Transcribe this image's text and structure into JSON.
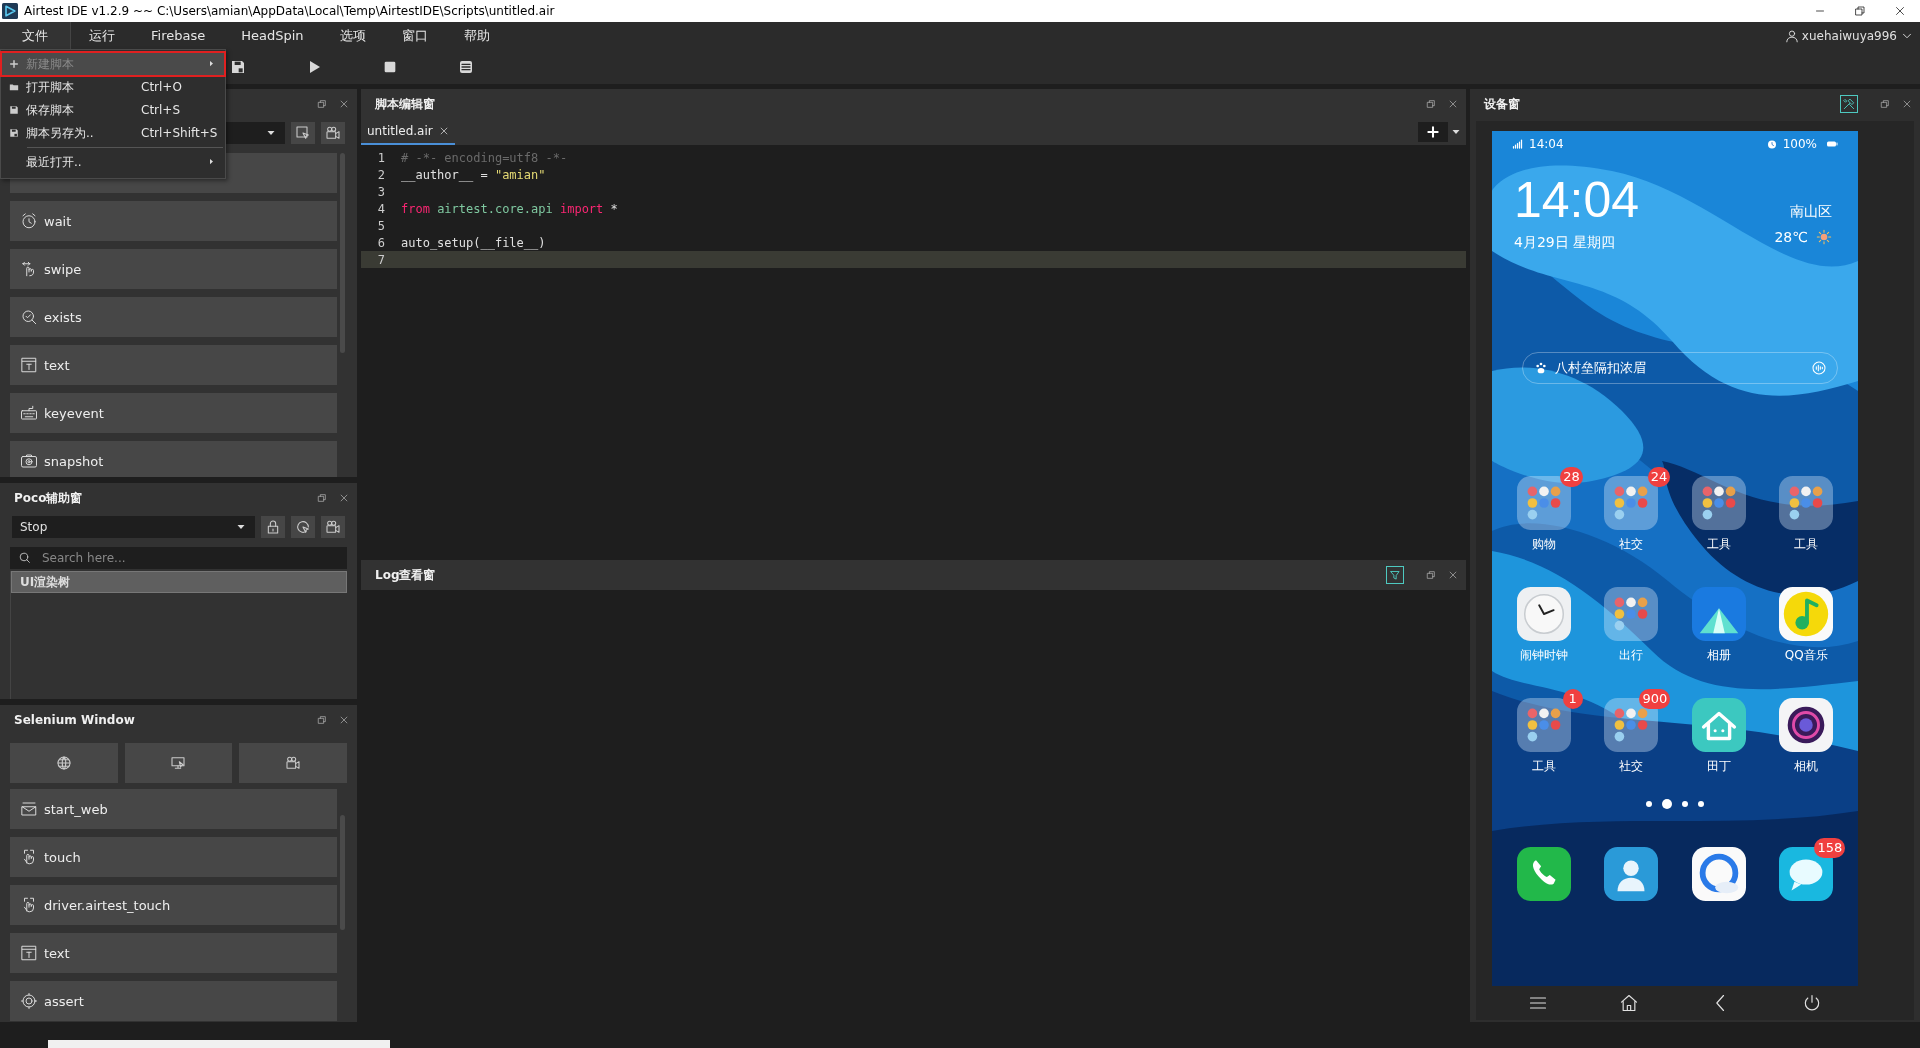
{
  "window": {
    "title": "Airtest IDE v1.2.9 ~~ C:\\Users\\amian\\AppData\\Local\\Temp\\AirtestIDE\\Scripts\\untitled.air"
  },
  "menubar": {
    "items": [
      {
        "label": "文件",
        "open": true
      },
      {
        "label": "运行",
        "open": false
      },
      {
        "label": "Firebase",
        "open": false
      },
      {
        "label": "HeadSpin",
        "open": false
      },
      {
        "label": "选项",
        "open": false
      },
      {
        "label": "窗口",
        "open": false
      },
      {
        "label": "帮助",
        "open": false
      }
    ],
    "user": "xuehaiwuya996"
  },
  "file_menu": {
    "items": [
      {
        "kind": "new",
        "label": "新建脚本",
        "highlighted": true,
        "disabled": true,
        "submenu": true,
        "outlined": true
      },
      {
        "kind": "open",
        "label": "打开脚本",
        "shortcut": "Ctrl+O",
        "highlighted": false,
        "disabled": false,
        "submenu": false,
        "outlined": false
      },
      {
        "kind": "save",
        "label": "保存脚本",
        "shortcut": "Ctrl+S",
        "highlighted": false,
        "disabled": false,
        "submenu": false,
        "outlined": false
      },
      {
        "kind": "save_as",
        "label": "脚本另存为..",
        "shortcut": "Ctrl+Shift+S",
        "highlighted": false,
        "disabled": false,
        "submenu": false,
        "outlined": false
      },
      {
        "kind": "separator"
      },
      {
        "kind": "recent",
        "label": "最近打开..",
        "highlighted": false,
        "disabled": false,
        "submenu": true,
        "outlined": false
      }
    ]
  },
  "toolbar": {
    "tools": [
      {
        "kind": "save_as"
      },
      {
        "kind": "run"
      },
      {
        "kind": "stop"
      },
      {
        "kind": "log"
      }
    ]
  },
  "airtest_panel": {
    "tools": [
      {
        "kind": "select"
      },
      {
        "kind": "record"
      }
    ],
    "actions": [
      {
        "kind": "wait",
        "label": "wait"
      },
      {
        "kind": "swipe",
        "label": "swipe"
      },
      {
        "kind": "exists",
        "label": "exists"
      },
      {
        "kind": "text",
        "label": "text"
      },
      {
        "kind": "keyevent",
        "label": "keyevent"
      },
      {
        "kind": "snapshot",
        "label": "snapshot"
      }
    ]
  },
  "poco_panel": {
    "title": "Poco辅助窗",
    "mode": "Stop",
    "tools": [
      {
        "kind": "lock"
      },
      {
        "kind": "refresh"
      },
      {
        "kind": "record"
      }
    ],
    "search": {
      "placeholder": "Search here..."
    },
    "tree": [
      {
        "label": "UI渲染树",
        "selected": true
      }
    ]
  },
  "selenium_panel": {
    "title": "Selenium Window",
    "tools": [
      {
        "kind": "globe"
      },
      {
        "kind": "screen"
      },
      {
        "kind": "record"
      }
    ],
    "actions": [
      {
        "kind": "start_web",
        "label": "start_web"
      },
      {
        "kind": "touch",
        "label": "touch"
      },
      {
        "kind": "touch",
        "label": "driver.airtest_touch"
      },
      {
        "kind": "text",
        "label": "text"
      },
      {
        "kind": "assert",
        "label": "assert"
      }
    ]
  },
  "editor": {
    "title": "脚本编辑窗",
    "tabs": [
      {
        "label": "untitled.air",
        "selected": true
      }
    ],
    "lines": [
      {
        "number": "1",
        "current": false,
        "tokens": [
          {
            "kind": "comment",
            "text": "# -*- encoding=utf8 -*-"
          }
        ]
      },
      {
        "number": "2",
        "current": false,
        "tokens": [
          {
            "kind": "plain",
            "text": "__author__ = "
          },
          {
            "kind": "string",
            "text": "\"amian\""
          }
        ]
      },
      {
        "number": "3",
        "current": false
      },
      {
        "number": "4",
        "current": false,
        "tokens": [
          {
            "kind": "keyword",
            "text": "from"
          },
          {
            "kind": "module",
            "text": " airtest.core.api "
          },
          {
            "kind": "keyword",
            "text": "import"
          },
          {
            "kind": "plain",
            "text": " *"
          }
        ]
      },
      {
        "number": "5",
        "current": false
      },
      {
        "number": "6",
        "current": false,
        "tokens": [
          {
            "kind": "plain",
            "text": "auto_setup(__file__)"
          }
        ]
      },
      {
        "number": "7",
        "current": true
      }
    ]
  },
  "log_panel": {
    "title": "Log查看窗"
  },
  "device_panel": {
    "title": "设备窗",
    "phone": {
      "status_time": "14:04",
      "battery": "100%",
      "clock": "14:04",
      "date": "4月29日 星期四",
      "location": "南山区",
      "temperature": "28℃",
      "search_text": "八村垒隔扣浓眉",
      "apps": [
        {
          "kind": "folder",
          "label": "购物",
          "badge": "28"
        },
        {
          "kind": "folder",
          "label": "社交",
          "badge": "24"
        },
        {
          "kind": "folder",
          "label": "工具"
        },
        {
          "kind": "folder",
          "label": "工具"
        },
        {
          "kind": "clock",
          "label": "闹钟时钟"
        },
        {
          "kind": "folder",
          "label": "出行"
        },
        {
          "kind": "gallery",
          "label": "相册"
        },
        {
          "kind": "music",
          "label": "QQ音乐"
        },
        {
          "kind": "folder",
          "label": "工具",
          "badge": "1"
        },
        {
          "kind": "folder",
          "label": "社交",
          "badge": "900"
        },
        {
          "kind": "home",
          "label": "田丁"
        },
        {
          "kind": "camera",
          "label": "相机"
        }
      ],
      "pages": [
        {
          "selected": false
        },
        {
          "selected": true
        },
        {
          "selected": false
        },
        {
          "selected": false
        }
      ],
      "dock": [
        {
          "kind": "phone"
        },
        {
          "kind": "contacts"
        },
        {
          "kind": "browser"
        },
        {
          "kind": "messages",
          "badge": "158"
        }
      ]
    },
    "nav": [
      {
        "kind": "menu"
      },
      {
        "kind": "home"
      },
      {
        "kind": "back"
      },
      {
        "kind": "power"
      }
    ]
  }
}
